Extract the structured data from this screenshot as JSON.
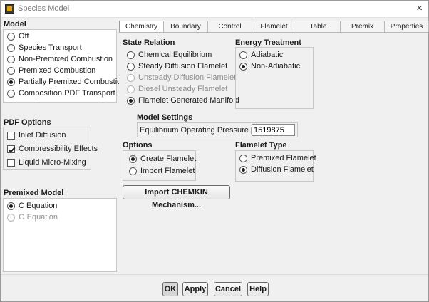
{
  "window": {
    "title": "Species Model",
    "close_glyph": "×"
  },
  "model": {
    "label": "Model",
    "options": [
      {
        "label": "Off",
        "selected": false
      },
      {
        "label": "Species Transport",
        "selected": false
      },
      {
        "label": "Non-Premixed Combustion",
        "selected": false
      },
      {
        "label": "Premixed Combustion",
        "selected": false
      },
      {
        "label": "Partially Premixed Combustion",
        "selected": true
      },
      {
        "label": "Composition PDF Transport",
        "selected": false
      }
    ]
  },
  "pdf_options": {
    "label": "PDF Options",
    "items": [
      {
        "label": "Inlet Diffusion",
        "checked": false
      },
      {
        "label": "Compressibility Effects",
        "checked": true
      },
      {
        "label": "Liquid Micro-Mixing",
        "checked": false
      }
    ]
  },
  "premixed_model": {
    "label": "Premixed Model",
    "options": [
      {
        "label": "C Equation",
        "selected": true,
        "disabled": false
      },
      {
        "label": "G Equation",
        "selected": false,
        "disabled": true
      }
    ]
  },
  "tabs": [
    {
      "label": "Chemistry",
      "active": true
    },
    {
      "label": "Boundary",
      "active": false
    },
    {
      "label": "Control",
      "active": false
    },
    {
      "label": "Flamelet",
      "active": false
    },
    {
      "label": "Table",
      "active": false
    },
    {
      "label": "Premix",
      "active": false
    },
    {
      "label": "Properties",
      "active": false
    }
  ],
  "state_relation": {
    "label": "State Relation",
    "options": [
      {
        "label": "Chemical Equilibrium",
        "selected": false,
        "disabled": false
      },
      {
        "label": "Steady Diffusion Flamelet",
        "selected": false,
        "disabled": false
      },
      {
        "label": "Unsteady Diffusion Flamelet",
        "selected": false,
        "disabled": true
      },
      {
        "label": "Diesel Unsteady Flamelet",
        "selected": false,
        "disabled": true
      },
      {
        "label": "Flamelet Generated Manifold",
        "selected": true,
        "disabled": false
      }
    ]
  },
  "energy_treatment": {
    "label": "Energy Treatment",
    "options": [
      {
        "label": "Adiabatic",
        "selected": false
      },
      {
        "label": "Non-Adiabatic",
        "selected": true
      }
    ]
  },
  "model_settings": {
    "label": "Model Settings",
    "pressure_label": "Equilibrium Operating Pressure [Pa]",
    "pressure_value": "1519875"
  },
  "options": {
    "label": "Options",
    "items": [
      {
        "label": "Create Flamelet",
        "selected": true
      },
      {
        "label": "Import Flamelet",
        "selected": false
      }
    ]
  },
  "flamelet_type": {
    "label": "Flamelet Type",
    "options": [
      {
        "label": "Premixed Flamelet",
        "selected": false
      },
      {
        "label": "Diffusion Flamelet",
        "selected": true
      }
    ]
  },
  "import_chemkin_label": "Import CHEMKIN Mechanism...",
  "buttons": {
    "ok": "OK",
    "apply": "Apply",
    "cancel": "Cancel",
    "help": "Help"
  }
}
